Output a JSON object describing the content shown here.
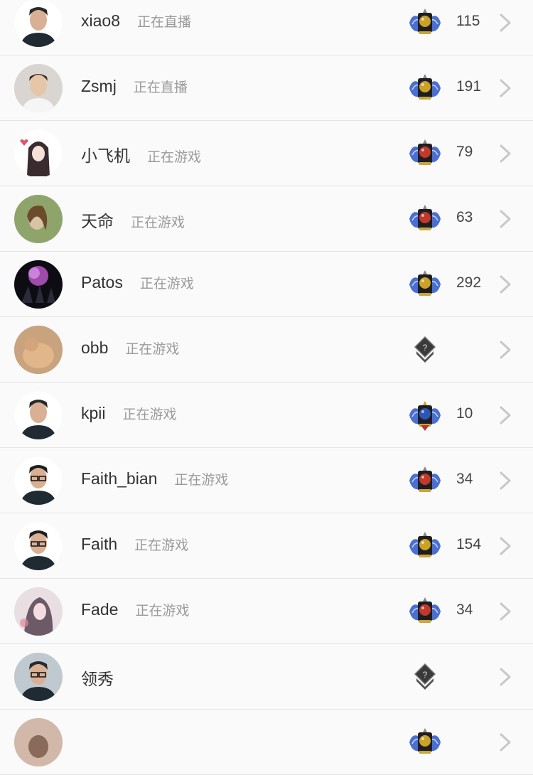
{
  "players": [
    {
      "name": "xiao8",
      "status": "正在直播",
      "rank_count": "115",
      "medal": "gold-wings-medal-icon",
      "medal_color": "#c9a227",
      "avatar": "man-portrait-dark-bg",
      "avatar_bg": "#ffffff",
      "avatar_fg": "#2a2a2a"
    },
    {
      "name": "Zsmj",
      "status": "正在直播",
      "rank_count": "191",
      "medal": "gold-wings-medal-icon",
      "medal_color": "#c9a227",
      "avatar": "man-portrait-light",
      "avatar_bg": "#d9d6d2",
      "avatar_fg": "#3b2a1e"
    },
    {
      "name": "小飞机",
      "status": "正在游戏",
      "rank_count": "79",
      "medal": "red-wings-medal-icon",
      "medal_color": "#c0392b",
      "avatar": "anime-girl-avatar",
      "avatar_bg": "#ffffff",
      "avatar_fg": "#3a2b2f"
    },
    {
      "name": "天命",
      "status": "正在游戏",
      "rank_count": "63",
      "medal": "red-wings-medal-icon",
      "medal_color": "#c0392b",
      "avatar": "girl-photo-green",
      "avatar_bg": "#8fa46a",
      "avatar_fg": "#d8c3a5"
    },
    {
      "name": "Patos",
      "status": "正在游戏",
      "rank_count": "292",
      "medal": "gold-wings-medal-icon",
      "medal_color": "#c9a227",
      "avatar": "dark-concert-avatar",
      "avatar_bg": "#0c0c12",
      "avatar_fg": "#c45bd0"
    },
    {
      "name": "obb",
      "status": "正在游戏",
      "rank_count": "",
      "medal": "unranked-medal-icon",
      "medal_color": "#555555",
      "avatar": "cat-photo-avatar",
      "avatar_bg": "#c9a27e",
      "avatar_fg": "#e0b68a"
    },
    {
      "name": "kpii",
      "status": "正在游戏",
      "rank_count": "10",
      "medal": "top-rank-medal-icon",
      "medal_color": "#2b56b8",
      "avatar": "man-portrait-dark-bg",
      "avatar_bg": "#ffffff",
      "avatar_fg": "#2a2a2a"
    },
    {
      "name": "Faith_bian",
      "status": "正在游戏",
      "rank_count": "34",
      "medal": "red-wings-medal-icon",
      "medal_color": "#c0392b",
      "avatar": "man-glasses-avatar",
      "avatar_bg": "#ffffff",
      "avatar_fg": "#1e1e1e"
    },
    {
      "name": "Faith",
      "status": "正在游戏",
      "rank_count": "154",
      "medal": "gold-wings-medal-icon",
      "medal_color": "#c9a227",
      "avatar": "man-glasses-avatar",
      "avatar_bg": "#ffffff",
      "avatar_fg": "#1e1e1e"
    },
    {
      "name": "Fade",
      "status": "正在游戏",
      "rank_count": "34",
      "medal": "red-wings-medal-icon",
      "medal_color": "#c0392b",
      "avatar": "anime-art-avatar",
      "avatar_bg": "#e9dfe3",
      "avatar_fg": "#6c5a66"
    },
    {
      "name": "领秀",
      "status": "",
      "rank_count": "",
      "medal": "unranked-medal-icon",
      "medal_color": "#555555",
      "avatar": "man-glasses-avatar",
      "avatar_bg": "#bfc9cf",
      "avatar_fg": "#2a2a2a"
    },
    {
      "name": "",
      "status": "",
      "rank_count": "",
      "medal": "gold-wings-medal-icon",
      "medal_color": "#c9a227",
      "avatar": "partial-avatar",
      "avatar_bg": "#d2b8a8",
      "avatar_fg": "#8a6a5a"
    }
  ],
  "colors": {
    "row_bg": "#fafafa",
    "divider": "#e4e4e4",
    "name_text": "#333333",
    "status_text": "#9a9a9a",
    "chevron": "#c7c7cc",
    "wing_blue": "#4a6fd1"
  },
  "chevron_icon": "chevron-right-icon"
}
